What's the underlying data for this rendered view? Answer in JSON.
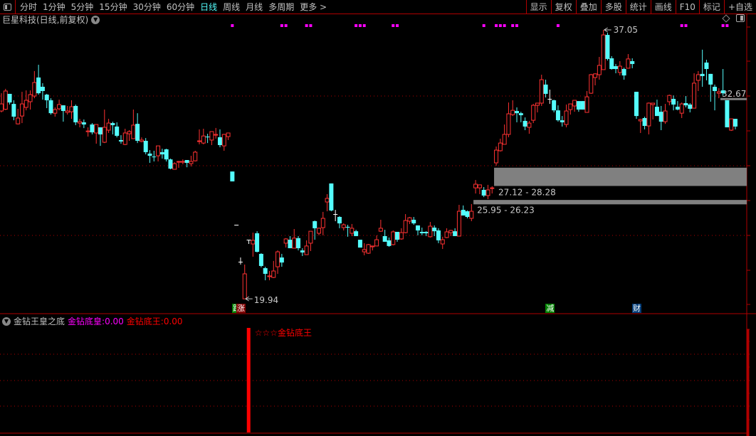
{
  "toolbar": {
    "tabs": [
      "分时",
      "1分钟",
      "5分钟",
      "15分钟",
      "30分钟",
      "60分钟",
      "日线",
      "周线",
      "月线",
      "多周期",
      "更多 >"
    ],
    "active_tab": "日线",
    "right_buttons": [
      "显示",
      "复权",
      "叠加",
      "多股",
      "统计",
      "画线",
      "F10",
      "标记",
      "+自选"
    ]
  },
  "chart_title": "巨星科技(日线,前复权)",
  "colors": {
    "up": "#ff3232",
    "down": "#54fcfc",
    "grid": "#b00000",
    "zone": "#808080",
    "signal": "#ff00ff",
    "bg": "#000000"
  },
  "price_labels": {
    "high": "37.05",
    "low": "19.94",
    "last": "32.67",
    "zone1": "27.12 - 28.28",
    "zone2": "25.95 - 26.23"
  },
  "zones": [
    {
      "low": 27.12,
      "high": 28.28,
      "start_index": 120
    },
    {
      "low": 25.95,
      "high": 26.23,
      "start_index": 115
    }
  ],
  "last_price": 32.67,
  "badges": [
    {
      "text": "跌",
      "bg": "#008000",
      "index": 57
    },
    {
      "text": "涨",
      "bg": "#800000",
      "index": 58
    },
    {
      "text": "减",
      "bg": "#008000",
      "index": 133
    },
    {
      "text": "财",
      "bg": "#003c78",
      "index": 154
    }
  ],
  "signal_indices": [
    56,
    68,
    69,
    74,
    75,
    86,
    87,
    88,
    95,
    96,
    117,
    120,
    121,
    122,
    124,
    125,
    135,
    165,
    166,
    175,
    176
  ],
  "indicator": {
    "name": "金钻王皇之底",
    "line1_label": "金钻底皇:",
    "line1_value": "0.00",
    "line1_color": "#ff00ff",
    "line2_label": "金钻底王:",
    "line2_value": "0.00",
    "line2_color": "#ff0000",
    "signal_text": "☆☆☆金钻底王",
    "signal_index": 59
  },
  "chart_data": {
    "type": "candlestick",
    "ylim": [
      18.4,
      37.9
    ],
    "candles_ohlc": [
      [
        31.89,
        33.02,
        31.8,
        32.34
      ],
      [
        32.0,
        33.3,
        31.95,
        33.16
      ],
      [
        32.98,
        32.98,
        32.3,
        32.43
      ],
      [
        32.34,
        32.57,
        31.3,
        31.53
      ],
      [
        31.07,
        32.03,
        31.03,
        31.44
      ],
      [
        31.57,
        33.11,
        31.12,
        32.34
      ],
      [
        32.12,
        33.2,
        31.93,
        32.57
      ],
      [
        32.48,
        33.2,
        31.98,
        32.93
      ],
      [
        32.84,
        34.43,
        32.7,
        33.7
      ],
      [
        34.02,
        34.83,
        32.93,
        33.02
      ],
      [
        33.43,
        33.66,
        32.61,
        33.16
      ],
      [
        32.93,
        32.98,
        32.07,
        32.57
      ],
      [
        32.57,
        32.7,
        31.66,
        31.75
      ],
      [
        31.75,
        32.12,
        31.53,
        31.98
      ],
      [
        32.03,
        32.61,
        31.93,
        32.3
      ],
      [
        32.25,
        32.25,
        31.21,
        31.89
      ],
      [
        31.8,
        32.21,
        31.66,
        31.89
      ],
      [
        31.84,
        32.57,
        31.39,
        32.16
      ],
      [
        32.21,
        32.3,
        30.99,
        31.17
      ],
      [
        31.12,
        31.39,
        30.85,
        31.21
      ],
      [
        31.17,
        31.35,
        30.8,
        31.03
      ],
      [
        30.57,
        30.85,
        30.26,
        30.62
      ],
      [
        31.03,
        31.12,
        30.4,
        30.53
      ],
      [
        30.49,
        31.03,
        29.81,
        31.03
      ],
      [
        30.85,
        30.85,
        29.67,
        30.4
      ],
      [
        29.9,
        31.98,
        29.85,
        30.85
      ],
      [
        30.67,
        31.39,
        30.49,
        31.12
      ],
      [
        31.12,
        31.21,
        30.4,
        30.99
      ],
      [
        30.9,
        31.17,
        30.21,
        30.31
      ],
      [
        30.04,
        30.35,
        29.81,
        29.95
      ],
      [
        29.76,
        30.76,
        29.72,
        30.49
      ],
      [
        30.44,
        30.67,
        29.99,
        30.58
      ],
      [
        30.13,
        31.98,
        30.13,
        30.99
      ],
      [
        31.07,
        31.75,
        29.85,
        29.99
      ],
      [
        29.95,
        30.21,
        29.9,
        30.04
      ],
      [
        29.99,
        30.17,
        29.13,
        29.27
      ],
      [
        29.18,
        29.4,
        28.59,
        29.04
      ],
      [
        28.99,
        29.36,
        28.68,
        28.95
      ],
      [
        29.04,
        29.67,
        28.68,
        29.67
      ],
      [
        29.27,
        29.49,
        28.86,
        29.13
      ],
      [
        29.45,
        29.49,
        28.68,
        28.81
      ],
      [
        28.81,
        28.86,
        28.18,
        28.22
      ],
      [
        28.18,
        28.63,
        28.18,
        28.54
      ],
      [
        28.63,
        28.72,
        28.27,
        28.68
      ],
      [
        28.63,
        28.81,
        28.5,
        28.68
      ],
      [
        28.77,
        28.77,
        28.31,
        28.59
      ],
      [
        28.54,
        29.04,
        28.36,
        28.68
      ],
      [
        28.72,
        29.36,
        28.68,
        29.27
      ],
      [
        29.95,
        30.72,
        29.77,
        29.99
      ],
      [
        29.85,
        30.76,
        29.77,
        30.3
      ],
      [
        30.26,
        30.44,
        29.85,
        30.22
      ],
      [
        30.04,
        30.58,
        29.72,
        30.58
      ],
      [
        30.35,
        30.81,
        30.13,
        30.4
      ],
      [
        30.22,
        30.72,
        29.58,
        29.72
      ],
      [
        29.67,
        30.44,
        29.36,
        30.4
      ],
      [
        30.26,
        30.44,
        30.04,
        30.49
      ],
      [
        28.04,
        28.04,
        27.41,
        27.41
      ],
      [
        24.65,
        24.65,
        24.65,
        24.65
      ],
      [
        22.3,
        22.57,
        22.12,
        22.3
      ],
      [
        19.94,
        22.12,
        19.94,
        21.53
      ],
      [
        23.7,
        23.7,
        23.43,
        23.7
      ],
      [
        23.43,
        24.15,
        22.62,
        23.66
      ],
      [
        24.11,
        24.24,
        22.89,
        22.93
      ],
      [
        22.8,
        22.84,
        21.94,
        22.03
      ],
      [
        21.89,
        21.98,
        21.12,
        21.53
      ],
      [
        21.35,
        21.71,
        21.12,
        21.4
      ],
      [
        21.3,
        22.35,
        21.26,
        21.71
      ],
      [
        21.98,
        23.02,
        21.53,
        22.93
      ],
      [
        22.57,
        22.8,
        21.98,
        22.25
      ],
      [
        23.48,
        23.8,
        23.2,
        23.75
      ],
      [
        23.7,
        23.93,
        23.16,
        23.16
      ],
      [
        23.16,
        24.38,
        23.16,
        23.8
      ],
      [
        23.8,
        23.93,
        23.02,
        23.16
      ],
      [
        23.02,
        23.16,
        22.66,
        22.89
      ],
      [
        22.75,
        23.66,
        22.75,
        23.3
      ],
      [
        23.48,
        24.24,
        22.98,
        24.24
      ],
      [
        24.88,
        24.92,
        23.7,
        24.43
      ],
      [
        24.11,
        24.47,
        23.98,
        24.43
      ],
      [
        24.47,
        25.47,
        23.98,
        25.06
      ],
      [
        26.1,
        26.6,
        25.51,
        26.33
      ],
      [
        27.28,
        27.28,
        25.51,
        25.56
      ],
      [
        25.33,
        25.6,
        24.88,
        25.33
      ],
      [
        25.15,
        25.2,
        24.43,
        24.74
      ],
      [
        24.47,
        24.74,
        24.29,
        24.65
      ],
      [
        24.52,
        24.65,
        23.89,
        24.47
      ],
      [
        24.11,
        24.7,
        23.93,
        24.43
      ],
      [
        24.24,
        24.33,
        23.93,
        23.93
      ],
      [
        23.7,
        23.7,
        23.2,
        23.2
      ],
      [
        22.93,
        23.48,
        22.71,
        23.07
      ],
      [
        22.84,
        23.43,
        22.8,
        23.39
      ],
      [
        23.25,
        23.3,
        23.02,
        23.3
      ],
      [
        23.3,
        23.98,
        23.3,
        23.7
      ],
      [
        24.24,
        24.97,
        24.2,
        24.43
      ],
      [
        23.93,
        24.33,
        23.57,
        23.57
      ],
      [
        23.66,
        23.84,
        23.25,
        23.3
      ],
      [
        23.39,
        24.29,
        23.34,
        24.2
      ],
      [
        24.2,
        24.2,
        23.57,
        23.7
      ],
      [
        23.75,
        24.43,
        23.7,
        24.15
      ],
      [
        24.15,
        25.33,
        24.11,
        24.92
      ],
      [
        24.88,
        25.15,
        24.7,
        25.1
      ],
      [
        24.97,
        25.15,
        24.65,
        24.74
      ],
      [
        24.61,
        24.61,
        23.98,
        24.29
      ],
      [
        24.2,
        24.47,
        23.98,
        24.11
      ],
      [
        24.2,
        24.24,
        23.93,
        24.11
      ],
      [
        23.89,
        24.83,
        23.84,
        24.56
      ],
      [
        24.47,
        24.61,
        23.93,
        24.24
      ],
      [
        24.29,
        24.43,
        23.48,
        23.66
      ],
      [
        23.43,
        23.89,
        23.11,
        23.7
      ],
      [
        23.84,
        24.43,
        23.8,
        24.2
      ],
      [
        24.15,
        24.33,
        23.93,
        24.29
      ],
      [
        24.24,
        24.43,
        23.93,
        23.93
      ],
      [
        23.93,
        25.92,
        23.93,
        25.51
      ],
      [
        25.6,
        25.88,
        25.24,
        25.24
      ],
      [
        25.51,
        25.56,
        25.06,
        25.15
      ],
      [
        25.06,
        25.97,
        24.88,
        25.51
      ],
      [
        27.0,
        27.5,
        26.64,
        27.23
      ],
      [
        27.0,
        27.19,
        26.6,
        27.19
      ],
      [
        26.87,
        27.05,
        26.41,
        26.51
      ],
      [
        26.51,
        27.19,
        26.28,
        26.87
      ],
      [
        26.96,
        27.1,
        26.64,
        27.0
      ],
      [
        28.59,
        29.63,
        28.41,
        29.4
      ],
      [
        29.36,
        30.13,
        29.31,
        29.85
      ],
      [
        29.77,
        31.03,
        29.77,
        30.4
      ],
      [
        30.4,
        32.43,
        30.22,
        31.71
      ],
      [
        31.66,
        32.57,
        31.57,
        31.93
      ],
      [
        31.89,
        32.12,
        31.17,
        31.75
      ],
      [
        31.75,
        31.84,
        31.17,
        31.62
      ],
      [
        31.26,
        31.48,
        30.67,
        30.9
      ],
      [
        30.85,
        31.26,
        30.44,
        31.12
      ],
      [
        31.3,
        32.34,
        31.12,
        32.25
      ],
      [
        32.25,
        32.39,
        31.8,
        32.39
      ],
      [
        32.39,
        34.2,
        32.21,
        33.88
      ],
      [
        33.57,
        33.88,
        32.75,
        32.98
      ],
      [
        32.66,
        33.25,
        32.34,
        32.66
      ],
      [
        32.57,
        32.61,
        31.8,
        31.93
      ],
      [
        31.93,
        32.25,
        31.21,
        31.3
      ],
      [
        31.3,
        31.57,
        30.9,
        31.17
      ],
      [
        31.03,
        32.3,
        30.85,
        31.89
      ],
      [
        31.98,
        32.34,
        31.66,
        32.34
      ],
      [
        32.21,
        32.57,
        31.84,
        32.57
      ],
      [
        32.52,
        32.52,
        31.84,
        31.98
      ],
      [
        32.52,
        32.52,
        31.98,
        31.98
      ],
      [
        31.8,
        33.16,
        31.8,
        32.79
      ],
      [
        33.02,
        34.25,
        32.98,
        34.2
      ],
      [
        34.02,
        34.29,
        33.52,
        34.25
      ],
      [
        34.2,
        35.33,
        33.88,
        34.79
      ],
      [
        34.52,
        37.05,
        34.52,
        36.73
      ],
      [
        36.73,
        36.87,
        35.1,
        35.2
      ],
      [
        35.24,
        35.38,
        34.52,
        34.56
      ],
      [
        34.74,
        34.88,
        34.29,
        34.56
      ],
      [
        34.34,
        35.06,
        34.15,
        34.74
      ],
      [
        34.56,
        34.65,
        33.88,
        34.15
      ],
      [
        34.61,
        35.51,
        34.61,
        35.2
      ],
      [
        35.06,
        35.24,
        34.61,
        34.88
      ],
      [
        33.11,
        33.11,
        31.39,
        31.57
      ],
      [
        31.26,
        31.39,
        30.49,
        31.35
      ],
      [
        31.44,
        31.53,
        30.72,
        30.94
      ],
      [
        30.94,
        32.43,
        30.4,
        32.39
      ],
      [
        32.3,
        32.39,
        31.35,
        32.39
      ],
      [
        32.16,
        32.61,
        31.57,
        31.57
      ],
      [
        31.84,
        32.21,
        30.67,
        31.21
      ],
      [
        31.21,
        32.34,
        31.07,
        31.89
      ],
      [
        32.48,
        32.93,
        32.25,
        32.88
      ],
      [
        32.66,
        32.88,
        31.93,
        32.3
      ],
      [
        32.16,
        32.52,
        31.93,
        31.98
      ],
      [
        31.75,
        32.43,
        31.44,
        32.34
      ],
      [
        32.39,
        32.84,
        32.12,
        32.25
      ],
      [
        32.3,
        32.39,
        31.8,
        32.03
      ],
      [
        32.07,
        34.29,
        32.07,
        33.66
      ],
      [
        33.84,
        34.43,
        33.16,
        34.2
      ],
      [
        34.25,
        35.79,
        33.43,
        34.11
      ],
      [
        34.97,
        35.15,
        33.84,
        34.56
      ],
      [
        34.25,
        34.25,
        32.48,
        33.57
      ],
      [
        33.43,
        33.57,
        31.93,
        33.16
      ],
      [
        33.02,
        33.34,
        32.7,
        33.11
      ],
      [
        33.2,
        34.56,
        32.88,
        33.02
      ],
      [
        32.57,
        32.57,
        30.85,
        30.85
      ],
      [
        30.67,
        31.39,
        30.62,
        31.39
      ],
      [
        31.39,
        31.39,
        30.72,
        30.9
      ]
    ],
    "high_index": 146,
    "low_index": 59
  }
}
